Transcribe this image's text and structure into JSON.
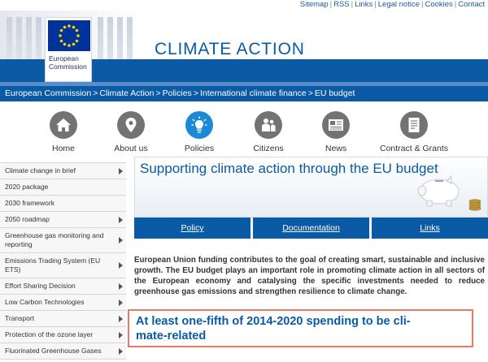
{
  "toplinks": {
    "items": [
      "Sitemap",
      "RSS",
      "Links",
      "Legal notice",
      "Cookies",
      "Contact"
    ]
  },
  "banner": {
    "logo_line1": "European",
    "logo_line2": "Commission",
    "site_title": "CLIMATE ACTION"
  },
  "breadcrumb": {
    "items": [
      "European Commission",
      "Climate Action",
      "Policies",
      "International climate finance",
      "EU budget"
    ],
    "separator": ">"
  },
  "nav": {
    "items": [
      {
        "label": "Home",
        "icon": "home-icon"
      },
      {
        "label": "About us",
        "icon": "location-pin-icon"
      },
      {
        "label": "Policies",
        "icon": "lightbulb-icon"
      },
      {
        "label": "Citizens",
        "icon": "people-icon"
      },
      {
        "label": "News",
        "icon": "newspaper-icon"
      },
      {
        "label": "Contract & Grants",
        "icon": "document-icon"
      }
    ],
    "active": "Policies"
  },
  "sidebar": {
    "items": [
      {
        "label": "Climate change in brief",
        "arrow": true
      },
      {
        "label": "2020 package",
        "arrow": false
      },
      {
        "label": "2030 framework",
        "arrow": false
      },
      {
        "label": "2050 roadmap",
        "arrow": true
      },
      {
        "label": "Greenhouse gas monitoring and reporting",
        "arrow": true
      },
      {
        "label": "Emissions Trading System (EU ETS)",
        "arrow": true
      },
      {
        "label": "Effort Sharing Decision",
        "arrow": true
      },
      {
        "label": "Low Carbon Technologies",
        "arrow": true
      },
      {
        "label": "Transport",
        "arrow": true
      },
      {
        "label": "Protection of the ozone layer",
        "arrow": true
      },
      {
        "label": "Fluorinated Greenhouse Gases",
        "arrow": true
      }
    ]
  },
  "content": {
    "hero_title": "Supporting climate action through the EU budget",
    "tabs": [
      "Policy",
      "Documentation",
      "Links"
    ],
    "intro": "European Union funding contributes to the goal of creating smart, sustainable and inclusive growth. The EU budget plays an important role in promoting climate action in all sectors of the European economy and catalysing the specific investments needed to reduce greenhouse gas emissions and strengthen resilience to climate change.",
    "highlight_line1": "At least one-fifth of 2014-2020 spending to be cli-",
    "highlight_line2": "mate-related"
  },
  "colors": {
    "brand_blue": "#0b5aa6",
    "nav_active": "#1a8ad6",
    "nav_inactive": "#737373",
    "highlight_border": "#e67a62"
  }
}
